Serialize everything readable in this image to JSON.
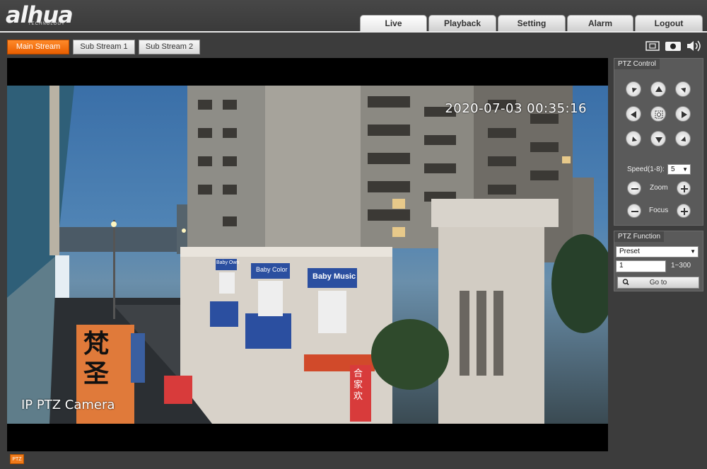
{
  "brand": {
    "logo": "alhua",
    "tagline": "TECHNOLOGY"
  },
  "nav": {
    "live": "Live",
    "playback": "Playback",
    "setting": "Setting",
    "alarm": "Alarm",
    "logout": "Logout"
  },
  "streams": {
    "main": "Main Stream",
    "sub1": "Sub Stream 1",
    "sub2": "Sub Stream 2"
  },
  "toolbar_icons": [
    "fullscreen-icon",
    "record-icon",
    "audio-icon"
  ],
  "video": {
    "timestamp": "2020-07-03 00:35:16",
    "camera_name": "IP PTZ Camera"
  },
  "signs": {
    "baby_own": "Baby Own",
    "baby_color": "Baby Color",
    "baby_music": "Baby Music",
    "big_chars": "梵 圣",
    "side_sign": "合家欢"
  },
  "ptz_control": {
    "title": "PTZ Control",
    "speed_label": "Speed(1-8):",
    "speed_value": "5",
    "zoom_label": "Zoom",
    "focus_label": "Focus"
  },
  "ptz_function": {
    "title": "PTZ Function",
    "mode": "Preset",
    "preset_value": "1",
    "range": "1~300",
    "goto_label": "Go to"
  },
  "footer": {
    "ptz_button": "PTZ"
  },
  "colors": {
    "accent": "#f07a1a",
    "background": "#3c3c3c"
  }
}
